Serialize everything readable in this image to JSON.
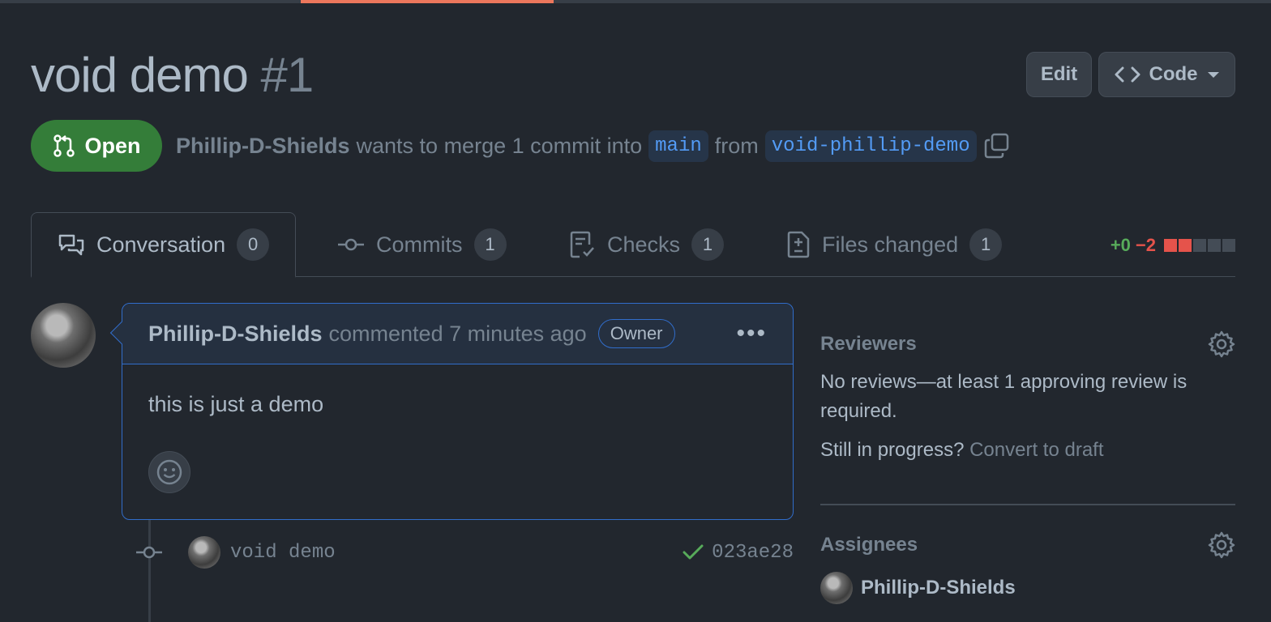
{
  "pr": {
    "title": "void demo",
    "number": "#1",
    "state": "Open",
    "author": "Phillip-D-Shields",
    "merge_text": "wants to merge 1 commit into",
    "base_branch": "main",
    "from_text": "from",
    "head_branch": "void-phillip-demo"
  },
  "header_buttons": {
    "edit": "Edit",
    "code": "Code"
  },
  "tabs": [
    {
      "label": "Conversation",
      "count": "0"
    },
    {
      "label": "Commits",
      "count": "1"
    },
    {
      "label": "Checks",
      "count": "1"
    },
    {
      "label": "Files changed",
      "count": "1"
    }
  ],
  "diffstat": {
    "additions": "+0",
    "deletions": "−2",
    "block_colors": [
      "#e5534b",
      "#e5534b",
      "#444c56",
      "#444c56",
      "#444c56"
    ]
  },
  "comment": {
    "author": "Phillip-D-Shields",
    "action": "commented 7 minutes ago",
    "badge": "Owner",
    "body": "this is just a demo"
  },
  "commit": {
    "message": "void demo",
    "sha": "023ae28"
  },
  "sidebar": {
    "reviewers": {
      "heading": "Reviewers",
      "text": "No reviews—at least 1 approving review is required.",
      "progress_text": "Still in progress?",
      "convert_link": "Convert to draft"
    },
    "assignees": {
      "heading": "Assignees",
      "user": "Phillip-D-Shields"
    }
  },
  "colors": {
    "accent": "#ec775c",
    "open_green": "#347d39",
    "link_blue": "#539bf5",
    "check_green": "#57ab5a"
  }
}
